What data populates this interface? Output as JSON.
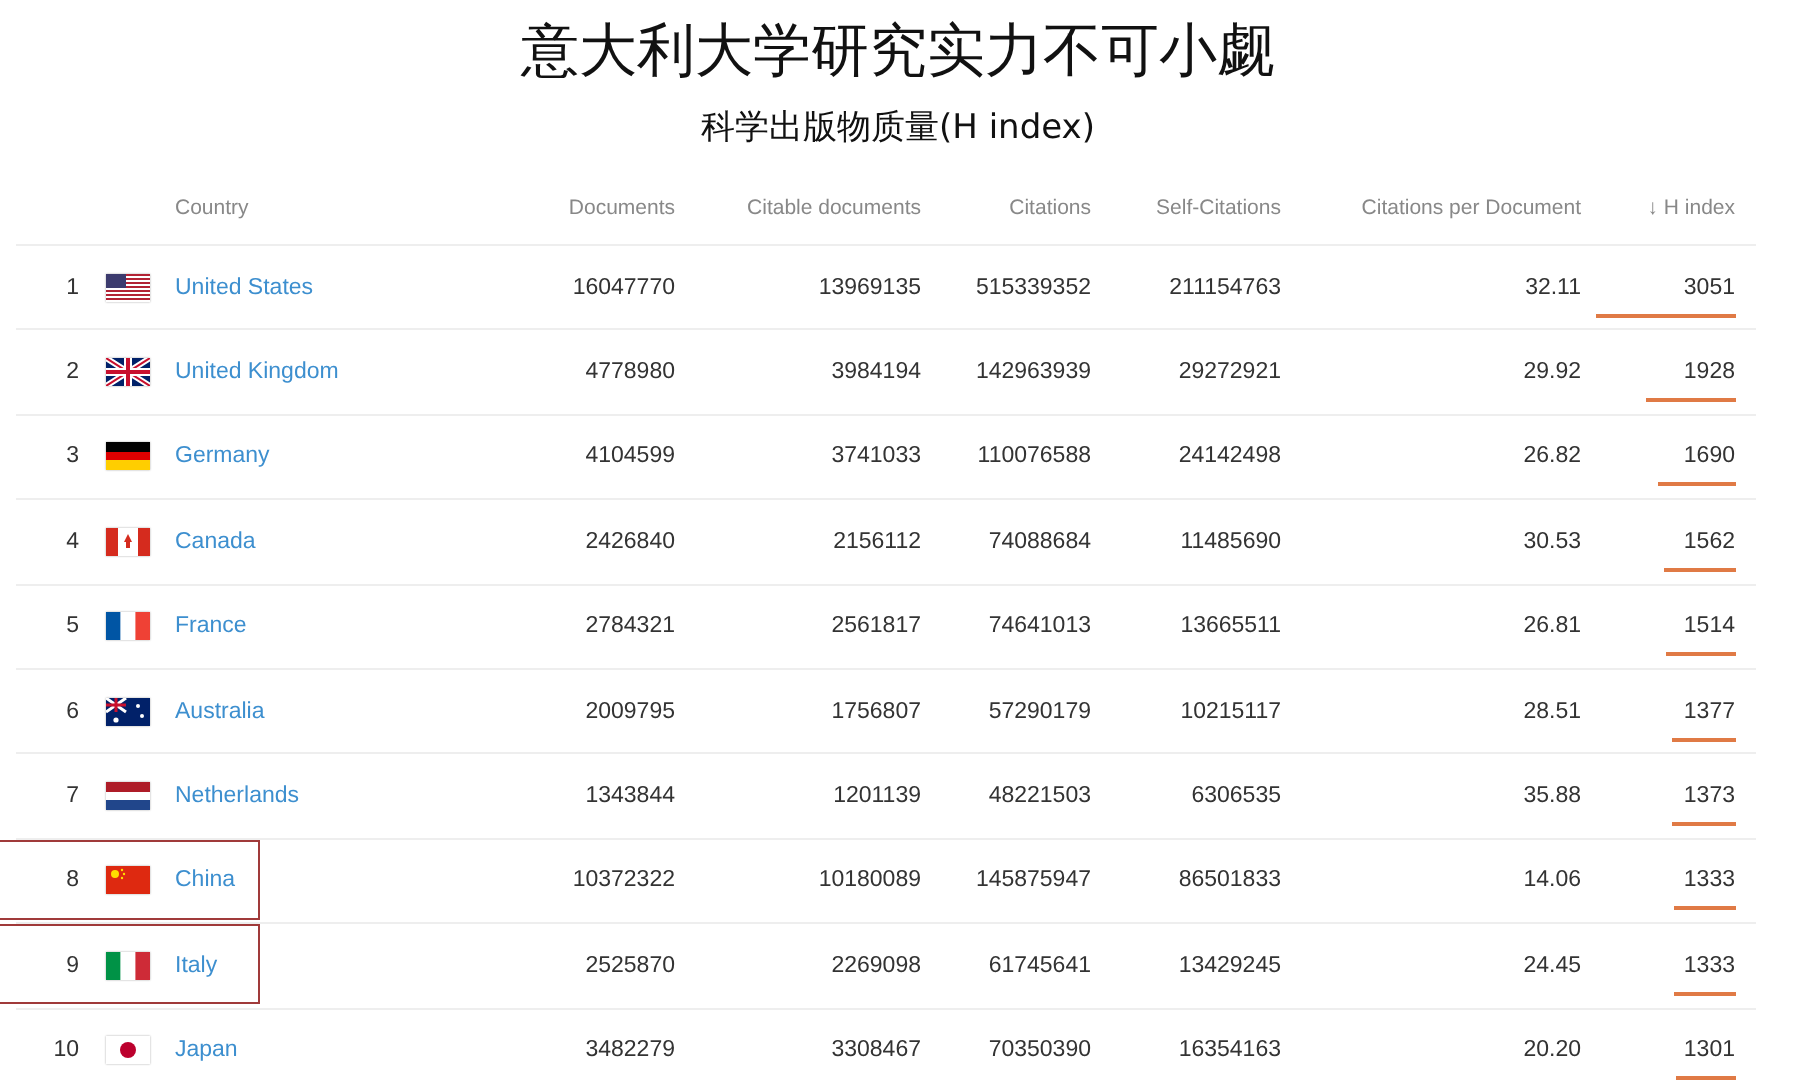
{
  "title": "意大利大学研究实力不可小觑",
  "subtitle": "科学出版物质量(H index)",
  "table": {
    "columns": [
      "Country",
      "Documents",
      "Citable documents",
      "Citations",
      "Self-Citations",
      "Citations per Document",
      "H index"
    ],
    "sort_arrow": "↓",
    "rows": [
      {
        "rank": "1",
        "country": "United States",
        "documents": "16047770",
        "citable": "13969135",
        "citations": "515339352",
        "self": "211154763",
        "cpd": "32.11",
        "h": "3051",
        "highlighted": false
      },
      {
        "rank": "2",
        "country": "United Kingdom",
        "documents": "4778980",
        "citable": "3984194",
        "citations": "142963939",
        "self": "29272921",
        "cpd": "29.92",
        "h": "1928",
        "highlighted": false
      },
      {
        "rank": "3",
        "country": "Germany",
        "documents": "4104599",
        "citable": "3741033",
        "citations": "110076588",
        "self": "24142498",
        "cpd": "26.82",
        "h": "1690",
        "highlighted": false
      },
      {
        "rank": "4",
        "country": "Canada",
        "documents": "2426840",
        "citable": "2156112",
        "citations": "74088684",
        "self": "11485690",
        "cpd": "30.53",
        "h": "1562",
        "highlighted": false
      },
      {
        "rank": "5",
        "country": "France",
        "documents": "2784321",
        "citable": "2561817",
        "citations": "74641013",
        "self": "13665511",
        "cpd": "26.81",
        "h": "1514",
        "highlighted": false
      },
      {
        "rank": "6",
        "country": "Australia",
        "documents": "2009795",
        "citable": "1756807",
        "citations": "57290179",
        "self": "10215117",
        "cpd": "28.51",
        "h": "1377",
        "highlighted": false
      },
      {
        "rank": "7",
        "country": "Netherlands",
        "documents": "1343844",
        "citable": "1201139",
        "citations": "48221503",
        "self": "6306535",
        "cpd": "35.88",
        "h": "1373",
        "highlighted": false
      },
      {
        "rank": "8",
        "country": "China",
        "documents": "10372322",
        "citable": "10180089",
        "citations": "145875947",
        "self": "86501833",
        "cpd": "14.06",
        "h": "1333",
        "highlighted": true
      },
      {
        "rank": "9",
        "country": "Italy",
        "documents": "2525870",
        "citable": "2269098",
        "citations": "61745641",
        "self": "13429245",
        "cpd": "24.45",
        "h": "1333",
        "highlighted": true
      },
      {
        "rank": "10",
        "country": "Japan",
        "documents": "3482279",
        "citable": "3308467",
        "citations": "70350390",
        "self": "16354163",
        "cpd": "20.20",
        "h": "1301",
        "highlighted": false
      }
    ]
  }
}
